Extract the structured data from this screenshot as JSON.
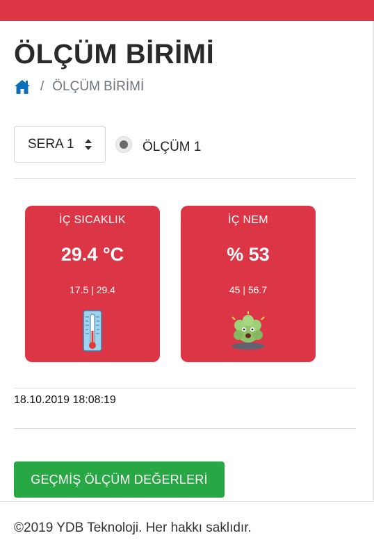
{
  "header": {
    "accent_color": "#dc3545"
  },
  "page": {
    "title": "ÖLÇÜM BİRİMİ"
  },
  "breadcrumb": {
    "home_icon": "home-icon",
    "separator": "/",
    "current": "ÖLÇÜM BİRİMİ"
  },
  "controls": {
    "greenhouse_select": {
      "value": "SERA 1"
    },
    "measurement_radio": {
      "label": "ÖLÇÜM 1",
      "checked": true
    }
  },
  "cards": {
    "temperature": {
      "title": "İÇ SICAKLIK",
      "value": "29.4 °C",
      "range": "17.5 | 29.4",
      "icon": "thermometer-icon",
      "color": "#dc3545"
    },
    "humidity": {
      "title": "İÇ NEM",
      "value": "% 53",
      "range": "45 | 56.7",
      "icon": "humidity-mascot-icon",
      "color": "#dc3545"
    }
  },
  "timestamp": "18.10.2019 18:08:19",
  "actions": {
    "history_button": "GEÇMİŞ ÖLÇÜM DEĞERLERİ",
    "history_button_color": "#28a745"
  },
  "footer": {
    "copyright": "©2019 YDB Teknoloji. Her hakkı saklıdır."
  }
}
